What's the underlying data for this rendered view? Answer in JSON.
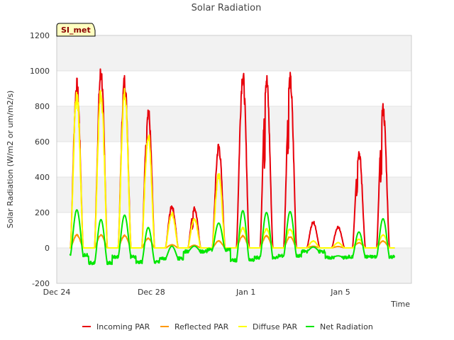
{
  "chart_data": {
    "type": "line",
    "title": "Solar Radiation",
    "xlabel": "Time",
    "ylabel": "Solar Radiation (W/m2 or um/m2/s)",
    "badge": "SI_met",
    "ylim": [
      -200,
      1200
    ],
    "xlim": [
      0,
      15
    ],
    "y_ticks": [
      -200,
      0,
      200,
      400,
      600,
      800,
      1000,
      1200
    ],
    "x_ticks": [
      {
        "pos": 0,
        "label": "Dec 24"
      },
      {
        "pos": 4,
        "label": "Dec 28"
      },
      {
        "pos": 8,
        "label": "Jan 1"
      },
      {
        "pos": 12,
        "label": "Jan 5"
      }
    ],
    "grid": "horizontal",
    "legend_position": "bottom",
    "colors": {
      "incoming": "#e8000b",
      "reflected": "#ff9900",
      "diffuse": "#ffff00",
      "net": "#00e600",
      "band": "#f2f2f2"
    },
    "series": [
      {
        "name": "Incoming PAR",
        "color": "#e8000b",
        "width": 2,
        "days": [
          {
            "c": 0.85,
            "p": 945
          },
          {
            "c": 1.87,
            "p": 1020
          },
          {
            "c": 2.87,
            "p": 970
          },
          {
            "c": 3.87,
            "p": 795,
            "notch": 0.15
          },
          {
            "c": 4.87,
            "p": 240
          },
          {
            "c": 5.82,
            "p": 230,
            "notch": 0.4
          },
          {
            "c": 6.85,
            "p": 590
          },
          {
            "c": 7.87,
            "p": 1000
          },
          {
            "c": 8.87,
            "p": 980,
            "notch": 0.4
          },
          {
            "c": 9.87,
            "p": 975,
            "notch": 0.3
          },
          {
            "c": 10.85,
            "p": 150
          },
          {
            "c": 11.9,
            "p": 120
          },
          {
            "c": 12.78,
            "p": 555,
            "notch": 0.3
          },
          {
            "c": 13.8,
            "p": 805,
            "notch": 0.4
          }
        ]
      },
      {
        "name": "Reflected PAR",
        "color": "#ff9900",
        "width": 2,
        "days": [
          {
            "c": 0.85,
            "p": 75
          },
          {
            "c": 1.87,
            "p": 75
          },
          {
            "c": 2.87,
            "p": 72
          },
          {
            "c": 3.87,
            "p": 55
          },
          {
            "c": 4.87,
            "p": 18
          },
          {
            "c": 5.82,
            "p": 15
          },
          {
            "c": 6.85,
            "p": 40
          },
          {
            "c": 7.87,
            "p": 70
          },
          {
            "c": 8.87,
            "p": 70
          },
          {
            "c": 9.87,
            "p": 65
          },
          {
            "c": 10.85,
            "p": 10
          },
          {
            "c": 11.9,
            "p": 8
          },
          {
            "c": 12.78,
            "p": 30
          },
          {
            "c": 13.8,
            "p": 40
          }
        ]
      },
      {
        "name": "Diffuse PAR",
        "color": "#ffff00",
        "width": 2,
        "days": [
          {
            "c": 0.85,
            "p": 880
          },
          {
            "c": 1.87,
            "p": 900
          },
          {
            "c": 2.87,
            "p": 900
          },
          {
            "c": 3.87,
            "p": 650
          },
          {
            "c": 4.87,
            "p": 200
          },
          {
            "c": 5.82,
            "p": 170
          },
          {
            "c": 6.85,
            "p": 420
          },
          {
            "c": 7.87,
            "p": 115
          },
          {
            "c": 8.87,
            "p": 110
          },
          {
            "c": 9.87,
            "p": 110
          },
          {
            "c": 10.85,
            "p": 40
          },
          {
            "c": 11.9,
            "p": 30
          },
          {
            "c": 12.78,
            "p": 50
          },
          {
            "c": 13.8,
            "p": 75
          }
        ]
      },
      {
        "name": "Net Radiation",
        "color": "#00e600",
        "width": 2,
        "days": [
          {
            "c": 0.85,
            "p": 255
          },
          {
            "c": 1.87,
            "p": 245
          },
          {
            "c": 2.87,
            "p": 235
          },
          {
            "c": 3.87,
            "p": 195
          },
          {
            "c": 4.87,
            "p": 70
          },
          {
            "c": 5.82,
            "p": 30
          },
          {
            "c": 6.85,
            "p": 150
          },
          {
            "c": 7.87,
            "p": 280
          },
          {
            "c": 8.87,
            "p": 255
          },
          {
            "c": 9.87,
            "p": 250
          },
          {
            "c": 10.85,
            "p": 25
          },
          {
            "c": 11.9,
            "p": 10
          },
          {
            "c": 12.78,
            "p": 140
          },
          {
            "c": 13.8,
            "p": 215
          }
        ],
        "night": [
          -40,
          -85,
          -50,
          -80,
          -60,
          -20,
          -10,
          -70,
          -55,
          -45,
          -20,
          -55,
          -50,
          -50,
          -25
        ]
      }
    ]
  }
}
